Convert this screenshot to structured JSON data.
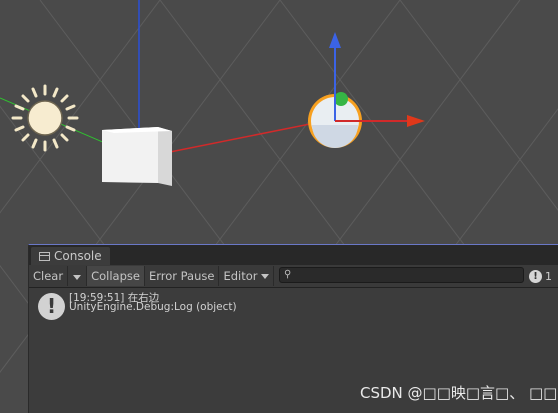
{
  "console": {
    "tab_label": "Console",
    "toolbar": {
      "clear": "Clear",
      "collapse": "Collapse",
      "error_pause": "Error Pause",
      "editor": "Editor",
      "search_placeholder": "",
      "message_count": "1"
    },
    "entries": [
      {
        "line1": "[19:59:51] 在右边",
        "line2": "UnityEngine.Debug:Log (object)"
      }
    ]
  },
  "scene": {
    "axis_colors": {
      "x": "#d12a2a",
      "y": "#2b4fd8",
      "z": "#30c030"
    },
    "background": "#4a4a4a"
  },
  "watermark": "CSDN @□□映□言□、 □□□"
}
